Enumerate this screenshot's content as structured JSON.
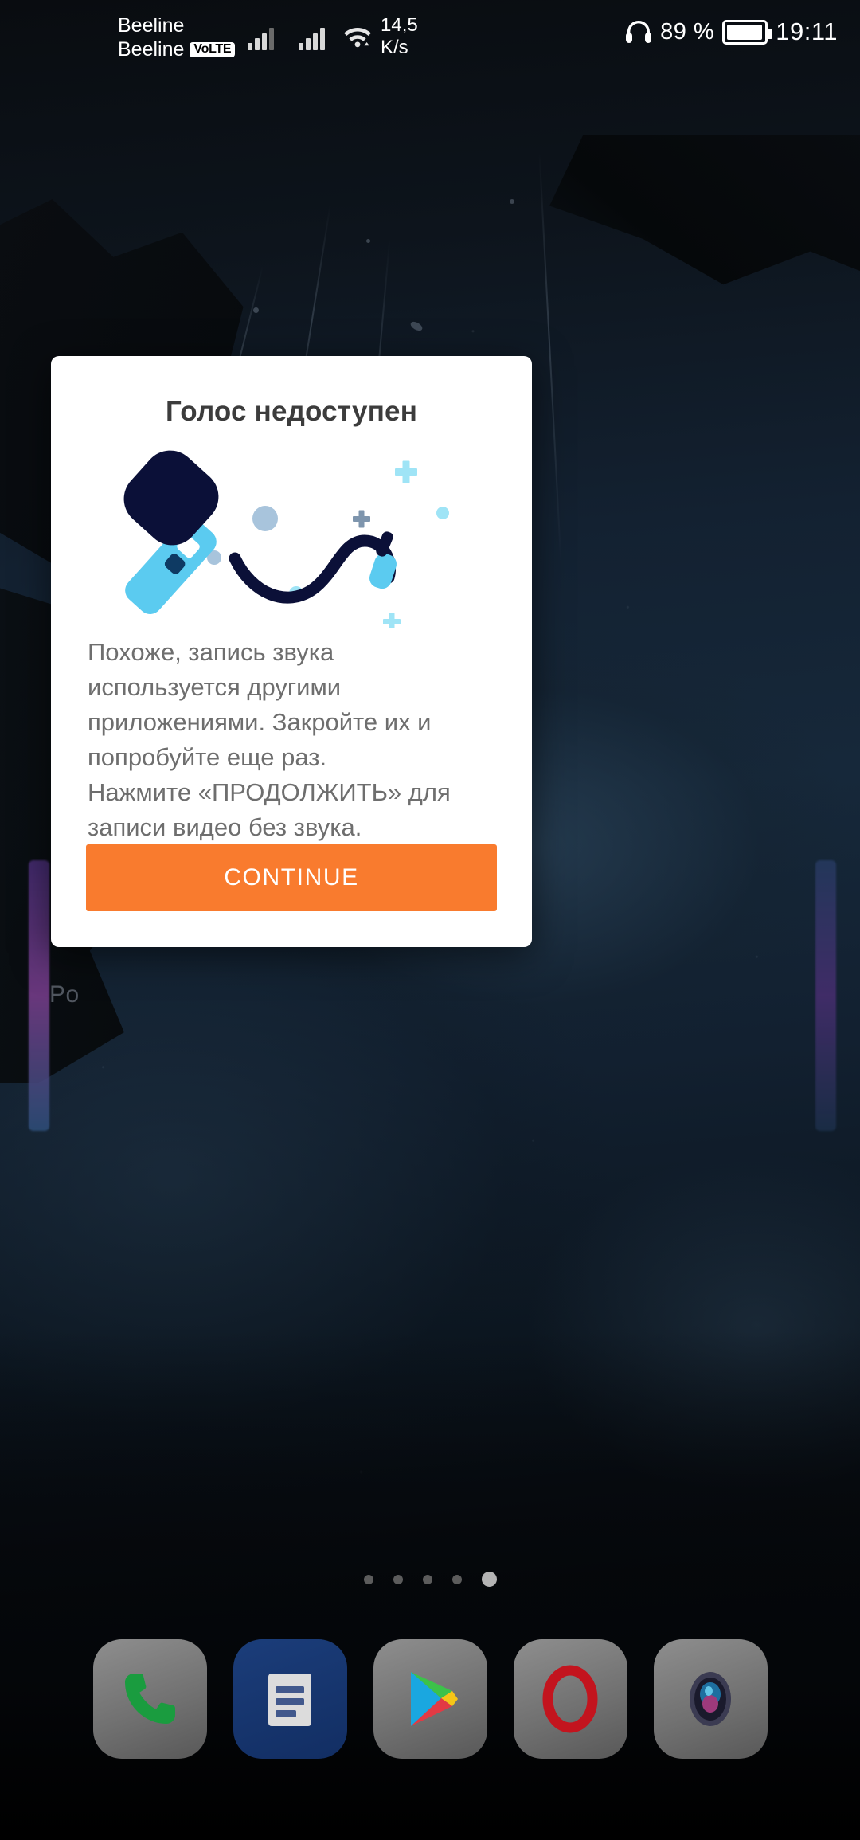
{
  "status_bar": {
    "carrier_line1": "Beeline",
    "carrier_line2": "Beeline",
    "volte_badge": "VoLTE",
    "network_speed_value": "14,5",
    "network_speed_unit": "K/s",
    "battery_percent": "89 %",
    "clock": "19:11",
    "icons": {
      "signal_1": "signal-bars-icon",
      "signal_2": "signal-bars-icon",
      "wifi": "wifi-icon",
      "headset": "headset-icon",
      "battery": "battery-icon"
    }
  },
  "wallpaper": {
    "overlay_text": "Po"
  },
  "dialog": {
    "title": "Голос недоступен",
    "illustration_name": "microphone-illustration",
    "message": "Похоже, запись звука\nиспользуется другими\nприложениями. Закройте их и\nпопробуйте еще раз.\n Нажмите «ПРОДОЛЖИТЬ» для\n записи видео без звука.",
    "button_label": "CONTINUE",
    "colors": {
      "button_background": "#F97B2E",
      "button_text": "#FFFFFF",
      "title_text": "#3C3C3C",
      "body_text": "#6E6E6E",
      "surface": "#FFFFFF",
      "illustration_dark": "#0B1038",
      "illustration_light": "#5BCBF0",
      "illustration_accent": "#A8C4DC",
      "illustration_plus": "#7E95AD",
      "illustration_plus_light": "#9FE4F6"
    }
  },
  "page_indicator": {
    "count": 5,
    "active_index": 4
  },
  "dock": {
    "apps": [
      {
        "name": "phone-app",
        "label": "Phone",
        "icon": "phone-icon"
      },
      {
        "name": "messages-app",
        "label": "Messages",
        "icon": "messages-icon"
      },
      {
        "name": "play-store-app",
        "label": "Play Store",
        "icon": "play-store-icon"
      },
      {
        "name": "opera-app",
        "label": "Opera",
        "icon": "opera-icon"
      },
      {
        "name": "camera-app",
        "label": "Camera",
        "icon": "camera-icon"
      }
    ]
  }
}
